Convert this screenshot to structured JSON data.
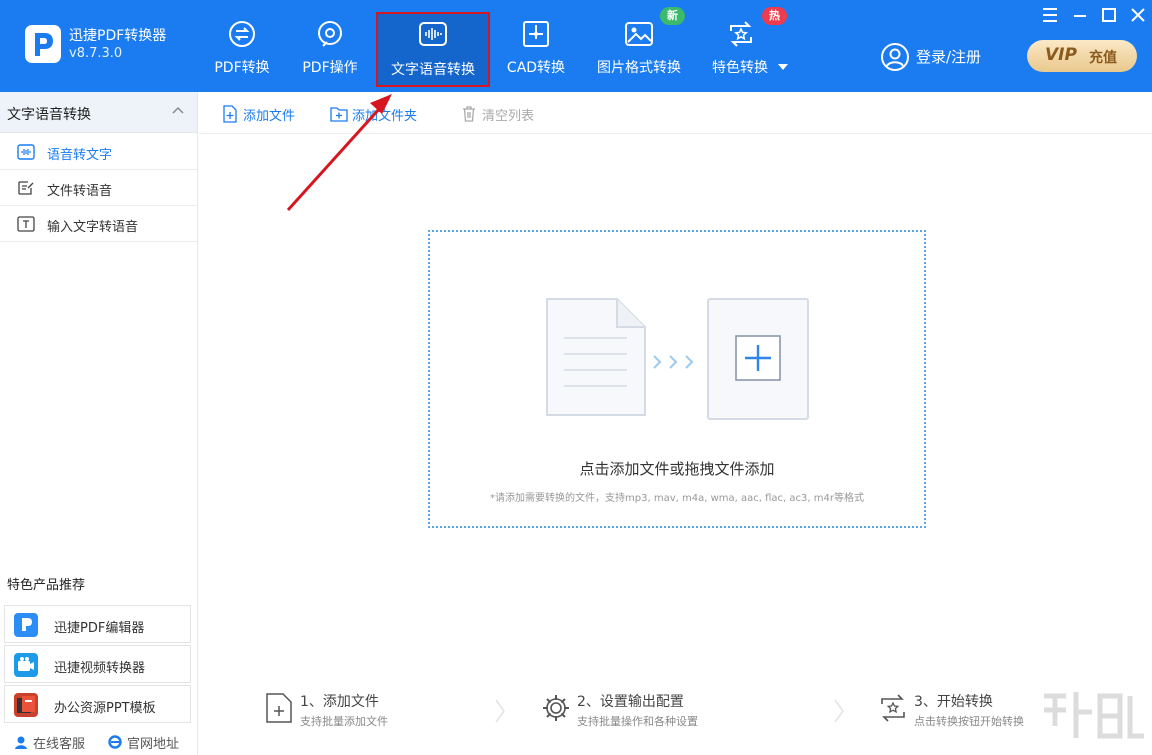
{
  "app": {
    "name": "迅捷PDF转换器",
    "version": "v8.7.3.0"
  },
  "nav": [
    {
      "label": "PDF转换",
      "icon": "pdf-convert-icon"
    },
    {
      "label": "PDF操作",
      "icon": "pdf-operate-icon"
    },
    {
      "label": "文字语音转换",
      "icon": "audio-wave-icon",
      "active": true
    },
    {
      "label": "CAD转换",
      "icon": "cad-icon"
    },
    {
      "label": "图片格式转换",
      "icon": "image-icon",
      "badge": "新"
    },
    {
      "label": "特色转换",
      "icon": "star-convert-icon",
      "badge": "热"
    }
  ],
  "header": {
    "login": "登录/注册",
    "vip_text": "VIP",
    "vip_action": "充值"
  },
  "sidebar": {
    "title": "文字语音转换",
    "items": [
      {
        "label": "语音转文字",
        "icon": "voice-to-text-icon",
        "active": true
      },
      {
        "label": "文件转语音",
        "icon": "file-to-voice-icon"
      },
      {
        "label": "输入文字转语音",
        "icon": "text-input-icon"
      }
    ],
    "rec_title": "特色产品推荐",
    "recommend": [
      {
        "label": "迅捷PDF编辑器",
        "icon": "pdf-editor-logo"
      },
      {
        "label": "迅捷视频转换器",
        "icon": "video-converter-logo"
      },
      {
        "label": "办公资源PPT模板",
        "icon": "ppt-template-logo"
      }
    ],
    "footer": [
      {
        "label": "在线客服",
        "icon": "support-icon"
      },
      {
        "label": "官网地址",
        "icon": "browser-icon"
      }
    ]
  },
  "toolbar": {
    "add_file": "添加文件",
    "add_folder": "添加文件夹",
    "clear": "清空列表"
  },
  "dropzone": {
    "title": "点击添加文件或拖拽文件添加",
    "hint": "*请添加需要转换的文件，支持mp3, mav, m4a, wma, aac, flac, ac3, m4r等格式"
  },
  "steps": [
    {
      "title": "1、添加文件",
      "desc": "支持批量添加文件"
    },
    {
      "title": "2、设置输出配置",
      "desc": "支持批量操作和各种设置"
    },
    {
      "title": "3、开始转换",
      "desc": "点击转换按钮开始转换"
    }
  ],
  "colors": {
    "primary": "#1a7cf0",
    "highlight_border": "#d6171f",
    "arrow": "#d6171f"
  }
}
